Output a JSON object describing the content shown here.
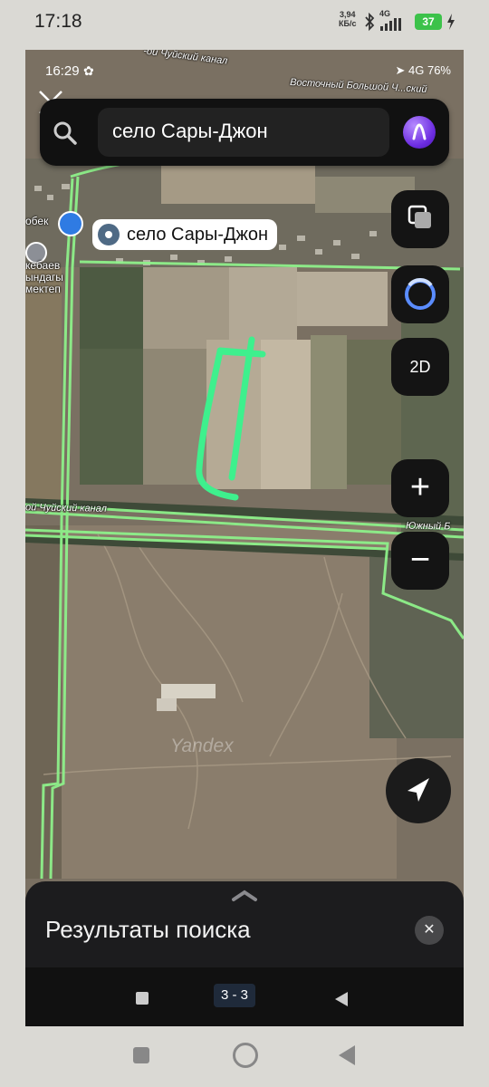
{
  "outer_status": {
    "time": "17:18",
    "speed_value": "3,94",
    "speed_unit": "КБ/с",
    "network": "4G",
    "battery": "37"
  },
  "inner_status": {
    "time": "16:29",
    "network": "4G",
    "battery": "76%"
  },
  "search": {
    "query": "село Сары-Джон",
    "search_icon": "search-icon",
    "voice_assistant_icon": "alice-icon"
  },
  "map": {
    "selected_place": "село Сары-Джон",
    "labels": {
      "canal_top": "-ой Чуйский канал",
      "canal_top_right": "Восточный Большой Ч...ский",
      "canal_middle": "ой Чуйский канал",
      "canal_south_right": "Южный Б",
      "poi_shop": "обек",
      "poi_school": "кебаев\nындагы\nмектеп"
    },
    "watermark": "Yandex",
    "drawn_outline_color": "#3ef08d",
    "road_color": "#8ef08a"
  },
  "controls": {
    "layers_icon": "layers-icon",
    "alice_icon": "alice-icon",
    "mode_label": "2D",
    "zoom_in": "+",
    "zoom_out": "−",
    "locate_icon": "navigation-arrow-icon"
  },
  "sheet": {
    "title": "Результаты поиска",
    "close": "✕"
  },
  "inner_nav": {
    "page": "3 - 3"
  }
}
